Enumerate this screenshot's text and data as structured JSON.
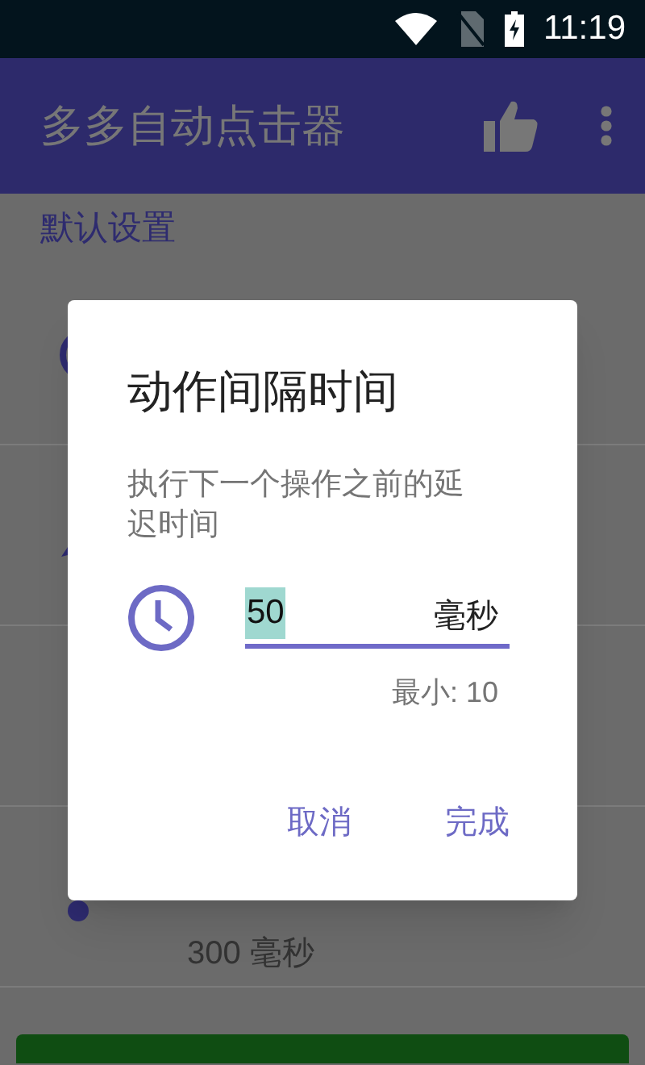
{
  "status_bar": {
    "time": "11:19"
  },
  "app_bar": {
    "title": "多多自动点击器"
  },
  "section": {
    "title": "默认设置"
  },
  "rows": [
    {
      "kind": "clock",
      "value": ""
    },
    {
      "kind": "arrow",
      "value": ""
    },
    {
      "kind": "blank",
      "value": ""
    },
    {
      "kind": "dot",
      "value": "300 毫秒"
    }
  ],
  "dialog": {
    "title": "动作间隔时间",
    "message": "执行下一个操作之前的延迟时间",
    "input": {
      "value": "50",
      "text_selected": true,
      "unit": "毫秒"
    },
    "hint": "最小: 10",
    "buttons": [
      {
        "label": "取消"
      },
      {
        "label": "完成"
      }
    ]
  }
}
